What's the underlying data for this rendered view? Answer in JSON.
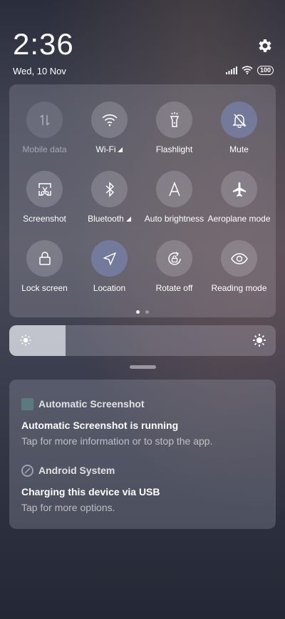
{
  "status": {
    "time": "2:36",
    "date": "Wed, 10 Nov",
    "battery": "100"
  },
  "quick_settings": {
    "tiles": [
      {
        "label": "Mobile data",
        "icon": "mobile-data-icon",
        "state": "disabled"
      },
      {
        "label": "Wi-Fi",
        "icon": "wifi-icon",
        "state": "off",
        "has_arrow": true
      },
      {
        "label": "Flashlight",
        "icon": "flashlight-icon",
        "state": "off"
      },
      {
        "label": "Mute",
        "icon": "bell-off-icon",
        "state": "on"
      },
      {
        "label": "Screenshot",
        "icon": "screenshot-icon",
        "state": "off"
      },
      {
        "label": "Bluetooth",
        "icon": "bluetooth-icon",
        "state": "off",
        "has_arrow": true
      },
      {
        "label": "Auto brightness",
        "icon": "auto-brightness-icon",
        "state": "off"
      },
      {
        "label": "Aeroplane mode",
        "icon": "airplane-icon",
        "state": "off"
      },
      {
        "label": "Lock screen",
        "icon": "lock-icon",
        "state": "off"
      },
      {
        "label": "Location",
        "icon": "location-icon",
        "state": "on"
      },
      {
        "label": "Rotate off",
        "icon": "rotate-lock-icon",
        "state": "off"
      },
      {
        "label": "Reading mode",
        "icon": "eye-icon",
        "state": "off"
      }
    ],
    "page_count": 2,
    "active_page": 1
  },
  "brightness": {
    "level": 0.21
  },
  "notifications": [
    {
      "app": "Automatic Screenshot",
      "title": "Automatic Screenshot is running",
      "body": "Tap for more information or to stop the app."
    },
    {
      "app": "Android System",
      "title": "Charging this device via USB",
      "body": "Tap for more options."
    }
  ],
  "colors": {
    "tile_on": "#7882aa",
    "app_icon_screenshot": "#5b7a7d"
  }
}
